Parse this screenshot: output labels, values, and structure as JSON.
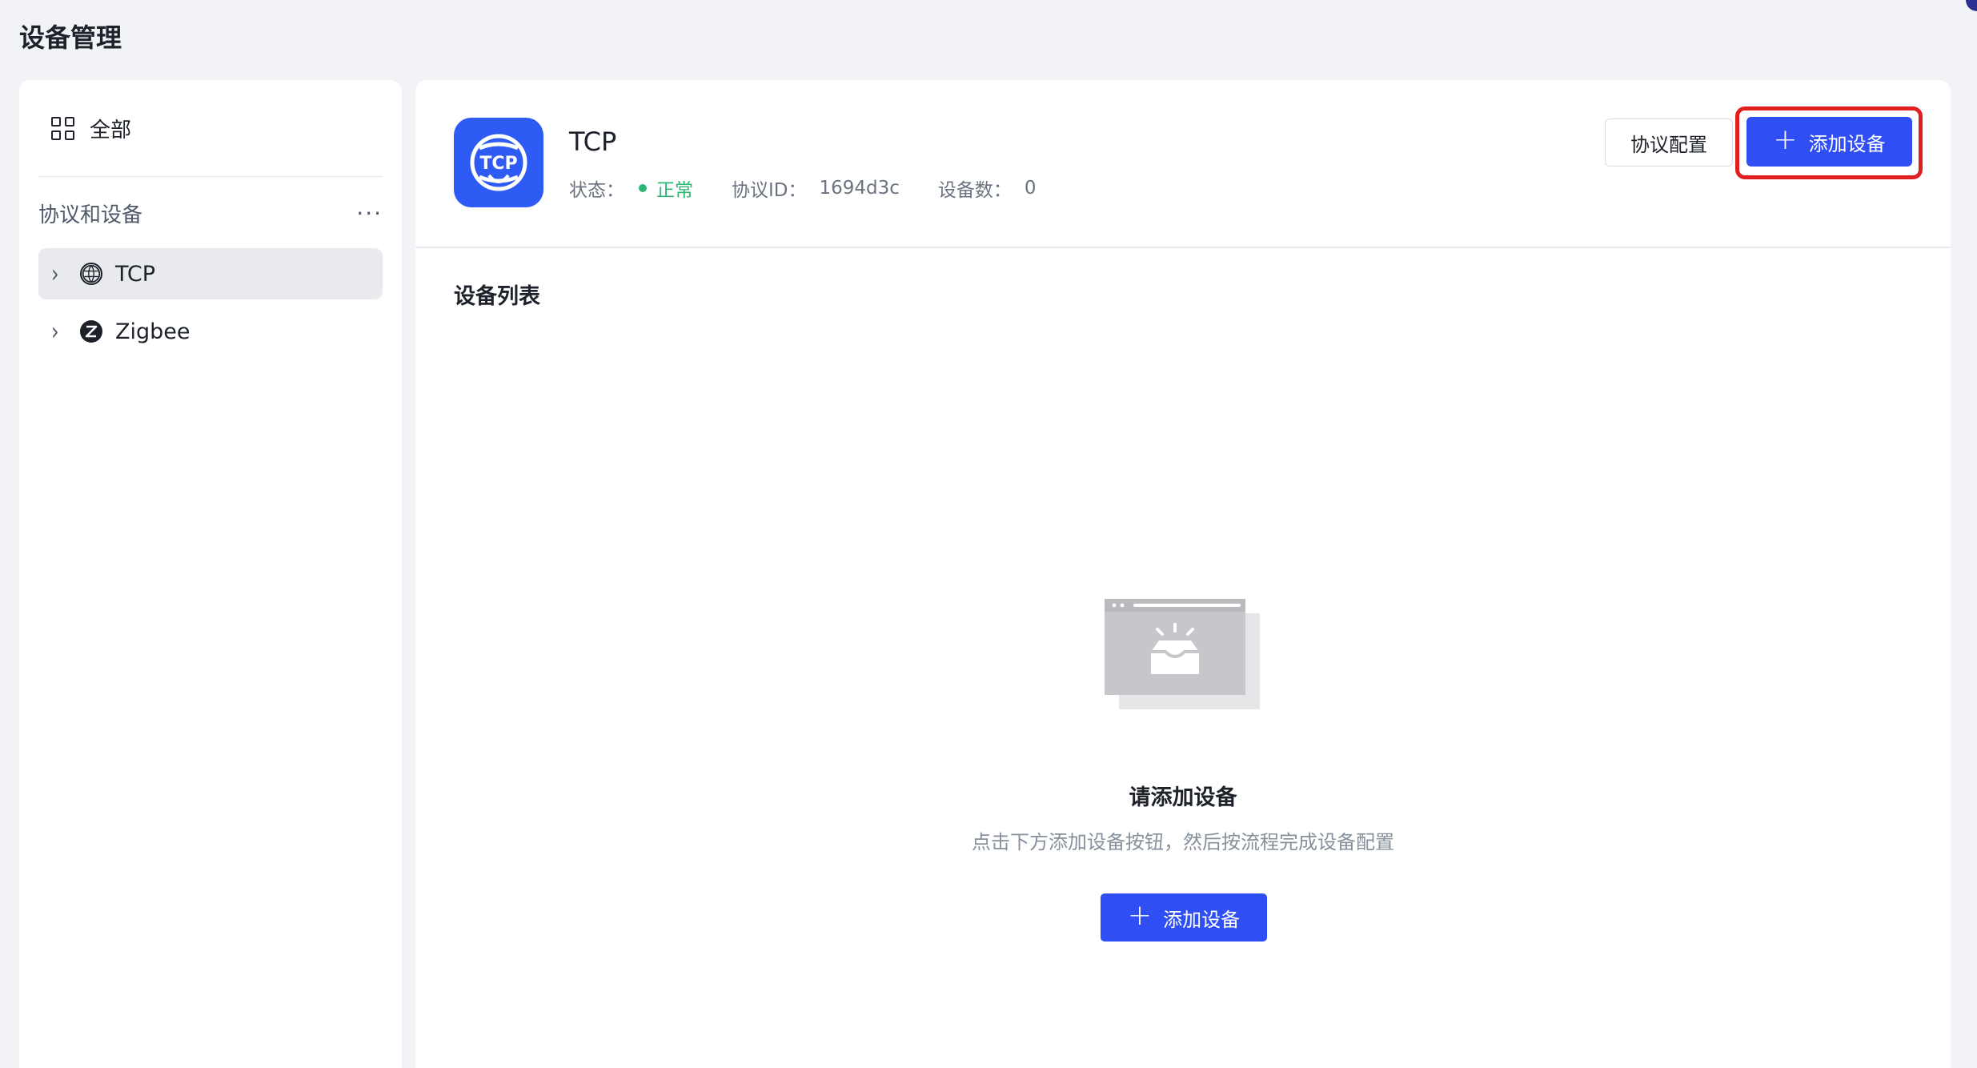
{
  "page": {
    "title": "设备管理"
  },
  "sidebar": {
    "all_label": "全部",
    "section_label": "协议和设备",
    "more_icon": "ellipsis-icon",
    "items": [
      {
        "label": "TCP",
        "icon": "tcp-icon",
        "active": true
      },
      {
        "label": "Zigbee",
        "icon": "zigbee-icon",
        "active": false
      }
    ]
  },
  "header": {
    "name": "TCP",
    "icon_text": "TCP",
    "status_label": "状态：",
    "status_value": "正常",
    "protocol_id_label": "协议ID：",
    "protocol_id_value": "1694d3c",
    "device_count_label": "设备数：",
    "device_count_value": "0",
    "config_button": "协议配置",
    "add_button": "添加设备"
  },
  "device_list": {
    "title": "设备列表",
    "empty_title": "请添加设备",
    "empty_desc": "点击下方添加设备按钮，然后按流程完成设备配置",
    "add_button": "添加设备"
  },
  "colors": {
    "primary": "#2f4ff5",
    "status_ok": "#2bb673",
    "highlight": "#e02020"
  }
}
